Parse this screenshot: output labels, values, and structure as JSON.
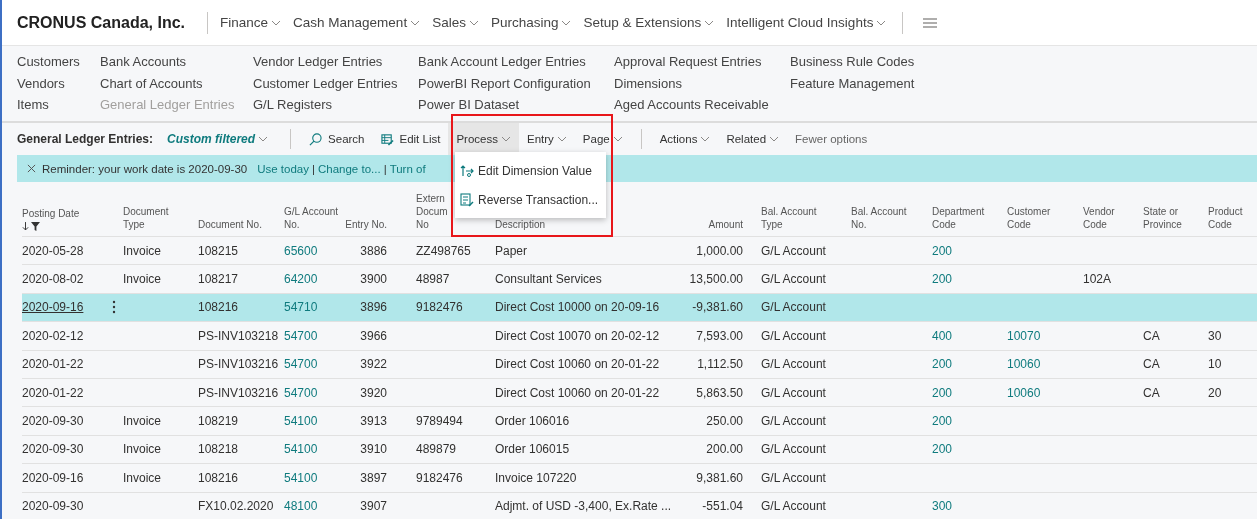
{
  "app": {
    "company": "CRONUS Canada, Inc.",
    "menus": [
      {
        "label": "Finance"
      },
      {
        "label": "Cash Management"
      },
      {
        "label": "Sales"
      },
      {
        "label": "Purchasing"
      },
      {
        "label": "Setup & Extensions"
      },
      {
        "label": "Intelligent Cloud Insights"
      }
    ]
  },
  "navigation": {
    "columns": [
      [
        {
          "label": "Customers",
          "current": false
        },
        {
          "label": "Vendors",
          "current": false
        },
        {
          "label": "Items",
          "current": false
        }
      ],
      [
        {
          "label": "Bank Accounts",
          "current": false
        },
        {
          "label": "Chart of Accounts",
          "current": false
        },
        {
          "label": "General Ledger Entries",
          "current": true
        }
      ],
      [
        {
          "label": "Vendor Ledger Entries",
          "current": false
        },
        {
          "label": "Customer Ledger Entries",
          "current": false
        },
        {
          "label": "G/L Registers",
          "current": false
        }
      ],
      [
        {
          "label": "Bank Account Ledger Entries",
          "current": false
        },
        {
          "label": "PowerBI Report Configuration",
          "current": false
        },
        {
          "label": "Power BI Dataset",
          "current": false
        }
      ],
      [
        {
          "label": "Approval Request Entries",
          "current": false
        },
        {
          "label": "Dimensions",
          "current": false
        },
        {
          "label": "Aged Accounts Receivable",
          "current": false
        }
      ],
      [
        {
          "label": "Business Rule Codes",
          "current": false
        },
        {
          "label": "Feature Management",
          "current": false
        }
      ]
    ]
  },
  "action_bar": {
    "page_title": "General Ledger Entries:",
    "filter": "Custom filtered",
    "actions": [
      {
        "kind": "icon",
        "label": "Search"
      },
      {
        "kind": "icon",
        "label": "Edit List"
      },
      {
        "kind": "menu",
        "label": "Process",
        "expanded": true
      },
      {
        "kind": "menu",
        "label": "Entry",
        "expanded": false
      },
      {
        "kind": "menu",
        "label": "Page",
        "expanded": false
      },
      {
        "kind": "divider"
      },
      {
        "kind": "menu",
        "label": "Actions",
        "expanded": false
      },
      {
        "kind": "menu",
        "label": "Related",
        "expanded": false
      },
      {
        "kind": "plain",
        "label": "Fewer options"
      }
    ]
  },
  "process_menu": {
    "items": [
      {
        "label": "Edit Dimension Value"
      },
      {
        "label": "Reverse Transaction..."
      }
    ]
  },
  "reminder": {
    "text": "Reminder: your work date is 2020-09-30",
    "separator": "|",
    "links": [
      "Use today",
      "Change to...",
      "Turn of"
    ]
  },
  "table": {
    "columns": [
      {
        "label": "Posting Date",
        "sorted_descending": true,
        "filtered": true
      },
      {
        "label": "Document\nType"
      },
      {
        "label": "Document No."
      },
      {
        "label": "G/L Account\nNo."
      },
      {
        "label": "Entry No."
      },
      {
        "label": "Extern\nDocum\nNo"
      },
      {
        "label": "Description"
      },
      {
        "label": "Amount"
      },
      {
        "label": "Bal. Account\nType"
      },
      {
        "label": "Bal. Account\nNo."
      },
      {
        "label": "Department\nCode"
      },
      {
        "label": "Customer\nCode"
      },
      {
        "label": "Vendor\nCode"
      },
      {
        "label": "State or\nProvince"
      },
      {
        "label": "Product\nCode"
      }
    ],
    "rows": [
      {
        "selected": false,
        "posting_date": "2020-05-28",
        "document_type": "Invoice",
        "document_no": "108215",
        "gl_account_no": "65600",
        "entry_no": "3886",
        "external_document_no": "ZZ498765",
        "description": "Paper",
        "amount": "1,000.00",
        "bal_account_type": "G/L Account",
        "department_code": "200"
      },
      {
        "selected": false,
        "posting_date": "2020-08-02",
        "document_type": "Invoice",
        "document_no": "108217",
        "gl_account_no": "64200",
        "entry_no": "3900",
        "external_document_no": "48987",
        "description": "Consultant Services",
        "amount": "13,500.00",
        "bal_account_type": "G/L Account",
        "department_code": "200",
        "vendor_code": "102A"
      },
      {
        "selected": true,
        "posting_date": "2020-09-16",
        "document_no": "108216",
        "gl_account_no": "54710",
        "entry_no": "3896",
        "external_document_no": "9182476",
        "description": "Direct Cost 10000 on 20-09-16",
        "amount": "-9,381.60",
        "bal_account_type": "G/L Account"
      },
      {
        "selected": false,
        "posting_date": "2020-02-12",
        "document_no": "PS-INV103218",
        "gl_account_no": "54700",
        "entry_no": "3966",
        "description": "Direct Cost 10070 on 20-02-12",
        "amount": "7,593.00",
        "bal_account_type": "G/L Account",
        "department_code": "400",
        "customer_code": "10070",
        "state_or_province": "CA",
        "product_code": "30"
      },
      {
        "selected": false,
        "posting_date": "2020-01-22",
        "document_no": "PS-INV103216",
        "gl_account_no": "54700",
        "entry_no": "3922",
        "description": "Direct Cost 10060 on 20-01-22",
        "amount": "1,112.50",
        "bal_account_type": "G/L Account",
        "department_code": "200",
        "customer_code": "10060",
        "state_or_province": "CA",
        "product_code": "10"
      },
      {
        "selected": false,
        "posting_date": "2020-01-22",
        "document_no": "PS-INV103216",
        "gl_account_no": "54700",
        "entry_no": "3920",
        "description": "Direct Cost 10060 on 20-01-22",
        "amount": "5,863.50",
        "bal_account_type": "G/L Account",
        "department_code": "200",
        "customer_code": "10060",
        "state_or_province": "CA",
        "product_code": "20"
      },
      {
        "selected": false,
        "posting_date": "2020-09-30",
        "document_type": "Invoice",
        "document_no": "108219",
        "gl_account_no": "54100",
        "entry_no": "3913",
        "external_document_no": "9789494",
        "description": "Order 106016",
        "amount": "250.00",
        "bal_account_type": "G/L Account",
        "department_code": "200"
      },
      {
        "selected": false,
        "posting_date": "2020-09-30",
        "document_type": "Invoice",
        "document_no": "108218",
        "gl_account_no": "54100",
        "entry_no": "3910",
        "external_document_no": "489879",
        "description": "Order 106015",
        "amount": "200.00",
        "bal_account_type": "G/L Account",
        "department_code": "200"
      },
      {
        "selected": false,
        "posting_date": "2020-09-16",
        "document_type": "Invoice",
        "document_no": "108216",
        "gl_account_no": "54100",
        "entry_no": "3897",
        "external_document_no": "9182476",
        "description": "Invoice 107220",
        "amount": "9,381.60",
        "bal_account_type": "G/L Account"
      },
      {
        "selected": false,
        "posting_date": "2020-09-30",
        "document_no": "FX10.02.2020",
        "gl_account_no": "48100",
        "entry_no": "3907",
        "description": "Adjmt. of USD -3,400, Ex.Rate ...",
        "amount": "-551.04",
        "bal_account_type": "G/L Account",
        "department_code": "300"
      }
    ]
  }
}
